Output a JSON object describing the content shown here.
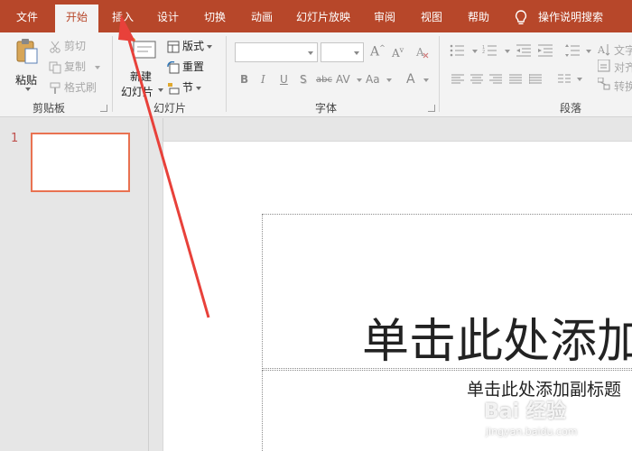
{
  "menu": {
    "tabs": [
      {
        "label": "文件"
      },
      {
        "label": "开始"
      },
      {
        "label": "插入"
      },
      {
        "label": "设计"
      },
      {
        "label": "切换"
      },
      {
        "label": "动画"
      },
      {
        "label": "幻灯片放映"
      },
      {
        "label": "审阅"
      },
      {
        "label": "视图"
      },
      {
        "label": "帮助"
      }
    ],
    "active_tab": "开始",
    "search_label": "操作说明搜索",
    "search_icon": "lightbulb-icon"
  },
  "ribbon": {
    "clipboard": {
      "paste": "粘贴",
      "cut": "剪切",
      "copy": "复制",
      "format_painter": "格式刷",
      "label": "剪贴板"
    },
    "slides": {
      "new_slide_line1": "新建",
      "new_slide_line2": "幻灯片",
      "layout": "版式",
      "reset": "重置",
      "section": "节",
      "label": "幻灯片"
    },
    "font": {
      "label": "字体",
      "font_name": "",
      "font_size": "",
      "buttons": [
        "B",
        "I",
        "U",
        "S",
        "abc",
        "AV",
        "Aa",
        "A"
      ]
    },
    "paragraph": {
      "label": "段落",
      "text_direction": "文字",
      "align_text": "对齐",
      "convert": "转换"
    }
  },
  "thumbnails": {
    "slide_number": "1"
  },
  "slide": {
    "title_placeholder": "单击此处添加",
    "subtitle_placeholder": "单击此处添加副标题"
  },
  "watermark": {
    "brand": "Bai 经验",
    "url": "jingyan.baidu.com"
  },
  "colors": {
    "accent": "#b7472a",
    "ribbon_bg": "#f3f3f3",
    "thumb_border": "#e97251",
    "arrow": "#e8413a"
  }
}
